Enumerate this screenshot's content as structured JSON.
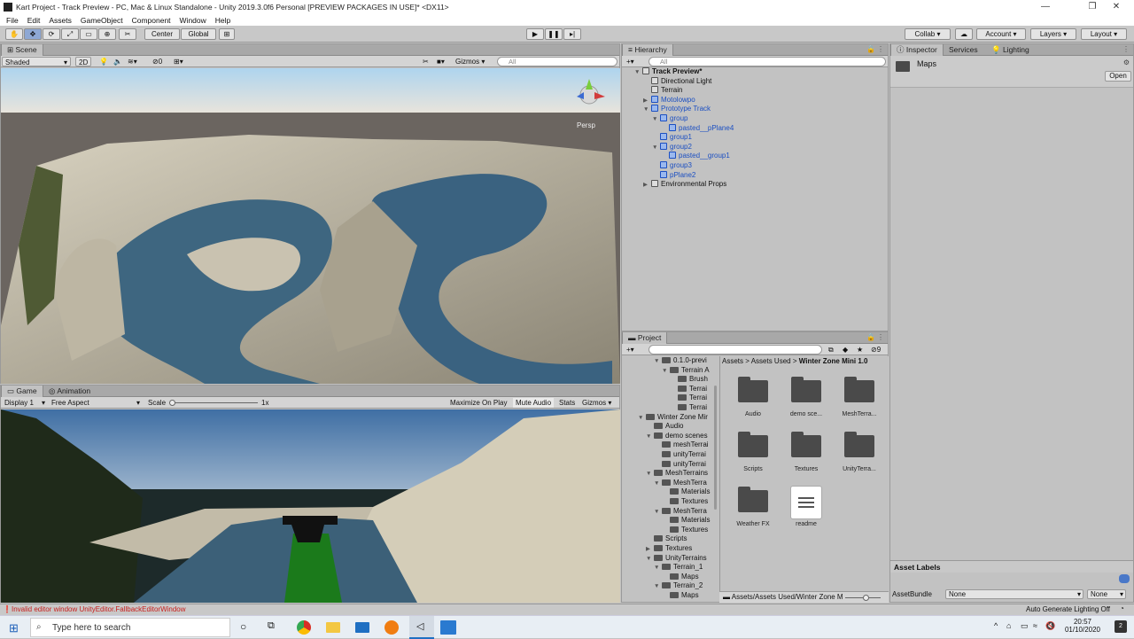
{
  "window": {
    "title": "Kart Project - Track Preview - PC, Mac & Linux Standalone - Unity 2019.3.0f6 Personal [PREVIEW PACKAGES IN USE]* <DX11>",
    "minimize": "—",
    "restore": "❐",
    "close": "✕"
  },
  "menu": [
    "File",
    "Edit",
    "Assets",
    "GameObject",
    "Component",
    "Window",
    "Help"
  ],
  "toolbar": {
    "center": "Center",
    "global": "Global",
    "collab": "Collab",
    "account": "Account",
    "layers": "Layers",
    "layout": "Layout"
  },
  "scene": {
    "tab": "Scene",
    "shading": "Shaded",
    "mode2d": "2D",
    "gizmo_count": "0",
    "gizmos": "Gizmos",
    "search_placeholder": "All",
    "persp": "Persp"
  },
  "game": {
    "tab": "Game",
    "tab2": "Animation",
    "display": "Display 1",
    "aspect": "Free Aspect",
    "scale_label": "Scale",
    "scale_value": "1x",
    "maximize": "Maximize On Play",
    "mute": "Mute Audio",
    "stats": "Stats",
    "gizmos": "Gizmos"
  },
  "hierarchy": {
    "tab": "Hierarchy",
    "search_placeholder": "All",
    "rows": [
      {
        "label": "Track Preview*",
        "indent": 0,
        "arrow": "▼",
        "icon": "unity-scene-icon",
        "blue": false,
        "bold": true
      },
      {
        "label": "Directional Light",
        "indent": 1,
        "arrow": "",
        "icon": "cube",
        "blue": false
      },
      {
        "label": "Terrain",
        "indent": 1,
        "arrow": "",
        "icon": "cube",
        "blue": false
      },
      {
        "label": "Motolowpo",
        "indent": 1,
        "arrow": "▶",
        "icon": "cube-blue",
        "blue": true
      },
      {
        "label": "Prototype Track",
        "indent": 1,
        "arrow": "▼",
        "icon": "cube-blue",
        "blue": true
      },
      {
        "label": "group",
        "indent": 2,
        "arrow": "▼",
        "icon": "cube-blue",
        "blue": true
      },
      {
        "label": "pasted__pPlane4",
        "indent": 3,
        "arrow": "",
        "icon": "cube-blue",
        "blue": true
      },
      {
        "label": "group1",
        "indent": 2,
        "arrow": "",
        "icon": "cube-blue",
        "blue": true
      },
      {
        "label": "group2",
        "indent": 2,
        "arrow": "▼",
        "icon": "cube-blue",
        "blue": true
      },
      {
        "label": "pasted__group1",
        "indent": 3,
        "arrow": "",
        "icon": "cube-blue",
        "blue": true
      },
      {
        "label": "group3",
        "indent": 2,
        "arrow": "",
        "icon": "cube-blue",
        "blue": true
      },
      {
        "label": "pPlane2",
        "indent": 2,
        "arrow": "",
        "icon": "cube-blue",
        "blue": true
      },
      {
        "label": "Environmental Props",
        "indent": 1,
        "arrow": "▶",
        "icon": "cube",
        "blue": false
      }
    ]
  },
  "project": {
    "tab": "Project",
    "hidden_count": "9",
    "breadcrumb": [
      "Assets",
      "Assets Used",
      "Winter Zone Mini 1.0"
    ],
    "tree": [
      {
        "label": "0.1.0-previ",
        "indent": 2,
        "arrow": "▼"
      },
      {
        "label": "Terrain A",
        "indent": 3,
        "arrow": "▼"
      },
      {
        "label": "Brush",
        "indent": 4,
        "arrow": ""
      },
      {
        "label": "Terrai",
        "indent": 4,
        "arrow": ""
      },
      {
        "label": "Terrai",
        "indent": 4,
        "arrow": ""
      },
      {
        "label": "Terrai",
        "indent": 4,
        "arrow": ""
      },
      {
        "label": "Winter Zone Mir",
        "indent": 0,
        "arrow": "▼"
      },
      {
        "label": "Audio",
        "indent": 1,
        "arrow": ""
      },
      {
        "label": "demo scenes",
        "indent": 1,
        "arrow": "▼"
      },
      {
        "label": "meshTerrai",
        "indent": 2,
        "arrow": ""
      },
      {
        "label": "unityTerrai",
        "indent": 2,
        "arrow": ""
      },
      {
        "label": "unityTerrai",
        "indent": 2,
        "arrow": ""
      },
      {
        "label": "MeshTerrains",
        "indent": 1,
        "arrow": "▼"
      },
      {
        "label": "MeshTerra",
        "indent": 2,
        "arrow": "▼"
      },
      {
        "label": "Materials",
        "indent": 3,
        "arrow": ""
      },
      {
        "label": "Textures",
        "indent": 3,
        "arrow": ""
      },
      {
        "label": "MeshTerra",
        "indent": 2,
        "arrow": "▼"
      },
      {
        "label": "Materials",
        "indent": 3,
        "arrow": ""
      },
      {
        "label": "Textures",
        "indent": 3,
        "arrow": ""
      },
      {
        "label": "Scripts",
        "indent": 1,
        "arrow": ""
      },
      {
        "label": "Textures",
        "indent": 1,
        "arrow": "▶"
      },
      {
        "label": "UnityTerrains",
        "indent": 1,
        "arrow": "▼"
      },
      {
        "label": "Terrain_1",
        "indent": 2,
        "arrow": "▼"
      },
      {
        "label": "Maps",
        "indent": 3,
        "arrow": ""
      },
      {
        "label": "Terrain_2",
        "indent": 2,
        "arrow": "▼"
      },
      {
        "label": "Maps",
        "indent": 3,
        "arrow": ""
      }
    ],
    "grid": [
      {
        "label": "Audio",
        "type": "folder"
      },
      {
        "label": "demo sce...",
        "type": "folder"
      },
      {
        "label": "MeshTerra...",
        "type": "folder"
      },
      {
        "label": "Scripts",
        "type": "folder"
      },
      {
        "label": "Textures",
        "type": "folder"
      },
      {
        "label": "UnityTerra...",
        "type": "folder"
      },
      {
        "label": "Weather FX",
        "type": "folder"
      },
      {
        "label": "readme",
        "type": "document"
      }
    ],
    "path": "Assets/Assets Used/Winter Zone M"
  },
  "inspector": {
    "tab": "Inspector",
    "tab2": "Services",
    "tab3": "Lighting",
    "asset_name": "Maps",
    "open_button": "Open",
    "asset_labels": "Asset Labels",
    "asset_bundle_label": "AssetBundle",
    "asset_bundle_value": "None",
    "asset_bundle_variant": "None"
  },
  "status": {
    "error": "Invalid editor window UnityEditor.FallbackEditorWindow",
    "lighting": "Auto Generate Lighting Off"
  },
  "taskbar": {
    "search_placeholder": "Type here to search",
    "time": "20:57",
    "date": "01/10/2020",
    "notification_count": "2"
  }
}
